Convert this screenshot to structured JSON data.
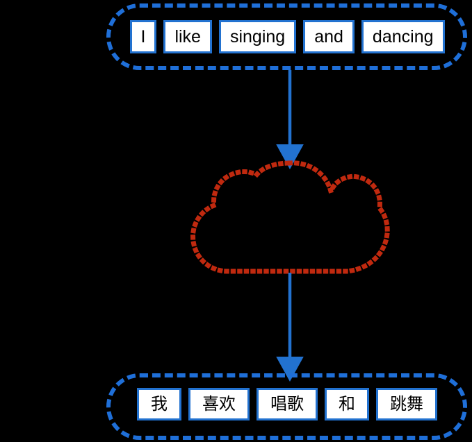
{
  "diagram": {
    "title": "Machine translation pipeline diagram",
    "background_color": "#000000",
    "accent_blue": "#2272d0",
    "cloud_red": "#c0290f",
    "token_fill": "#ffffff"
  },
  "source": {
    "group_label": "source-sentence-group",
    "language": "English",
    "tokens": [
      {
        "text": "I"
      },
      {
        "text": "like"
      },
      {
        "text": "singing"
      },
      {
        "text": "and"
      },
      {
        "text": "dancing"
      }
    ]
  },
  "target": {
    "group_label": "target-sentence-group",
    "language": "Chinese",
    "tokens": [
      {
        "text": "我"
      },
      {
        "text": "喜欢"
      },
      {
        "text": "唱歌"
      },
      {
        "text": "和"
      },
      {
        "text": "跳舞"
      }
    ]
  },
  "model": {
    "shape": "cloud",
    "outline_style": "dotted",
    "outline_color": "#c0290f",
    "label": ""
  },
  "arrows": [
    {
      "name": "encode-arrow",
      "from": "source-sentence-group",
      "to": "model-cloud",
      "color": "#2272d0",
      "label": ""
    },
    {
      "name": "decode-arrow",
      "from": "model-cloud",
      "to": "target-sentence-group",
      "color": "#2272d0",
      "label": ""
    }
  ]
}
